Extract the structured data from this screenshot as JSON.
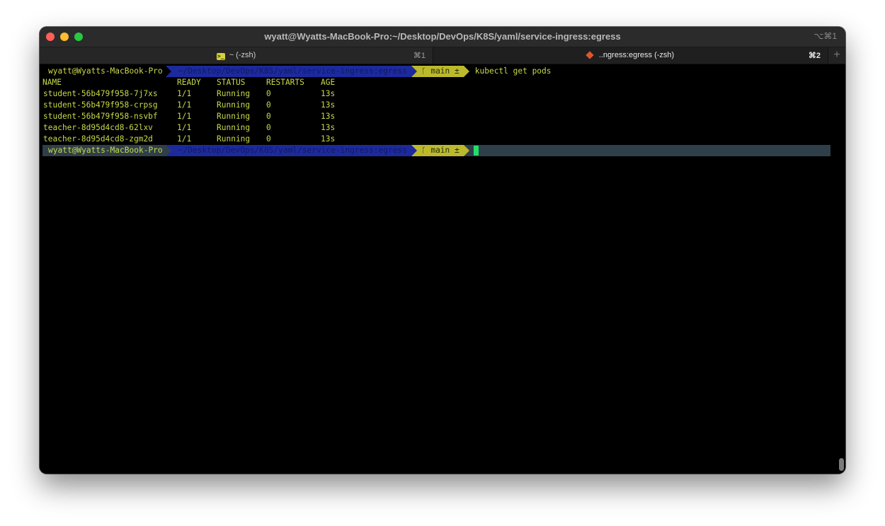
{
  "window": {
    "title": "wyatt@Wyatts-MacBook-Pro:~/Desktop/DevOps/K8S/yaml/service-ingress:egress",
    "title_shortcut": "⌥⌘1"
  },
  "tabs": [
    {
      "label": "~ (-zsh)",
      "shortcut": "⌘1",
      "icon": "terminal-icon"
    },
    {
      "label": "..ngress:egress (-zsh)",
      "shortcut": "⌘2",
      "icon": "git-icon"
    }
  ],
  "new_tab_symbol": "+",
  "prompt": {
    "user": "wyatt@Wyatts-MacBook-Pro",
    "dir": "~/Desktop/DevOps/K8S/yaml/service-ingress:egress",
    "branch_symbol": "ᚴ",
    "branch": "main ±",
    "command": "kubectl get pods"
  },
  "table": {
    "headers": [
      "NAME",
      "READY",
      "STATUS",
      "RESTARTS",
      "AGE"
    ],
    "rows": [
      [
        "student-56b479f958-7j7xs",
        "1/1",
        "Running",
        "0",
        "13s"
      ],
      [
        "student-56b479f958-crpsg",
        "1/1",
        "Running",
        "0",
        "13s"
      ],
      [
        "student-56b479f958-nsvbf",
        "1/1",
        "Running",
        "0",
        "13s"
      ],
      [
        "teacher-8d95d4cd8-62lxv",
        "1/1",
        "Running",
        "0",
        "13s"
      ],
      [
        "teacher-8d95d4cd8-zgm2d",
        "1/1",
        "Running",
        "0",
        "13s"
      ]
    ]
  },
  "colors": {
    "text": "#c8d84a",
    "dir_bg": "#1d2a9e",
    "git_bg": "#bcb92c",
    "cursor": "#22e06a",
    "active_line": "#2f3f4a"
  }
}
